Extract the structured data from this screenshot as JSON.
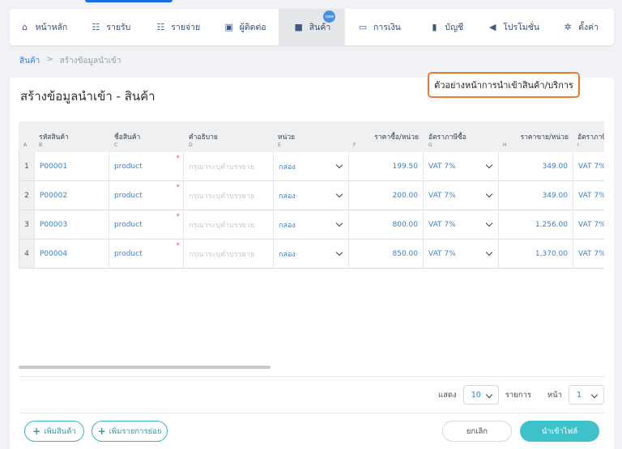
{
  "nav": {
    "items": [
      {
        "label": "หน้าหลัก",
        "icon": "home-icon"
      },
      {
        "label": "รายรับ",
        "icon": "income-icon"
      },
      {
        "label": "รายจ่าย",
        "icon": "expense-icon"
      },
      {
        "label": "ผู้ติดต่อ",
        "icon": "contacts-icon"
      },
      {
        "label": "สินค้า",
        "icon": "box-icon",
        "badge": "new"
      },
      {
        "label": "การเงิน",
        "icon": "money-icon"
      },
      {
        "label": "บัญชี",
        "icon": "ledger-icon"
      },
      {
        "label": "โปรโมชั่น",
        "icon": "megaphone-icon"
      },
      {
        "label": "ตั้งค่า",
        "icon": "gear-icon"
      }
    ]
  },
  "breadcrumb": {
    "root": "สินค้า",
    "sep": ">",
    "current": "สร้างข้อมูลนำเข้า"
  },
  "page": {
    "title": "สร้างข้อมูลนำเข้า - สินค้า",
    "note": "ตัวอย่างหน้าการนำเข้าสินค้า/บริการ"
  },
  "table": {
    "columns": [
      {
        "letter": "A",
        "label": ""
      },
      {
        "letter": "B",
        "label": "รหัสสินค้า"
      },
      {
        "letter": "C",
        "label": "ชื่อสินค้า"
      },
      {
        "letter": "D",
        "label": "คำอธิบาย"
      },
      {
        "letter": "E",
        "label": "หน่วย"
      },
      {
        "letter": "F",
        "label": "ราคาซื้อ/หน่วย"
      },
      {
        "letter": "G",
        "label": "อัตราภาษีซื้อ"
      },
      {
        "letter": "H",
        "label": "ราคาขาย/หน่วย"
      },
      {
        "letter": "I",
        "label": "อัตราภาษี"
      }
    ],
    "desc_placeholder": "กรุณาระบุคำบรรยาย",
    "rows": [
      {
        "num": "1",
        "code": "P00001",
        "name": "product",
        "unit": "กล่อง",
        "buy": "199.50",
        "buy_tax": "VAT 7%",
        "sell": "349.00",
        "sell_tax": "VAT 7%"
      },
      {
        "num": "2",
        "code": "P00002",
        "name": "product",
        "unit": "กล่อง",
        "buy": "200.00",
        "buy_tax": "VAT 7%",
        "sell": "349.00",
        "sell_tax": "VAT 7%"
      },
      {
        "num": "3",
        "code": "P00003",
        "name": "product",
        "unit": "กล่อง",
        "buy": "800.00",
        "buy_tax": "VAT 7%",
        "sell": "1,256.00",
        "sell_tax": "VAT 7%"
      },
      {
        "num": "4",
        "code": "P00004",
        "name": "product",
        "unit": "กล่อง",
        "buy": "850.00",
        "buy_tax": "VAT 7%",
        "sell": "1,370.00",
        "sell_tax": "VAT 7%"
      }
    ]
  },
  "pager": {
    "show": "แสดง",
    "per_page": "10",
    "items": "รายการ",
    "page_label": "หน้า",
    "page": "1"
  },
  "buttons": {
    "add_product": "เพิ่มสินค้า",
    "add_sub": "เพิ่มรายการย่อย",
    "cancel": "ยกเลิก",
    "import": "นำเข้าไฟล์"
  },
  "colors": {
    "accent": "#3fc1c9",
    "link": "#3a7fd5",
    "note_border": "#ef7a2e"
  }
}
